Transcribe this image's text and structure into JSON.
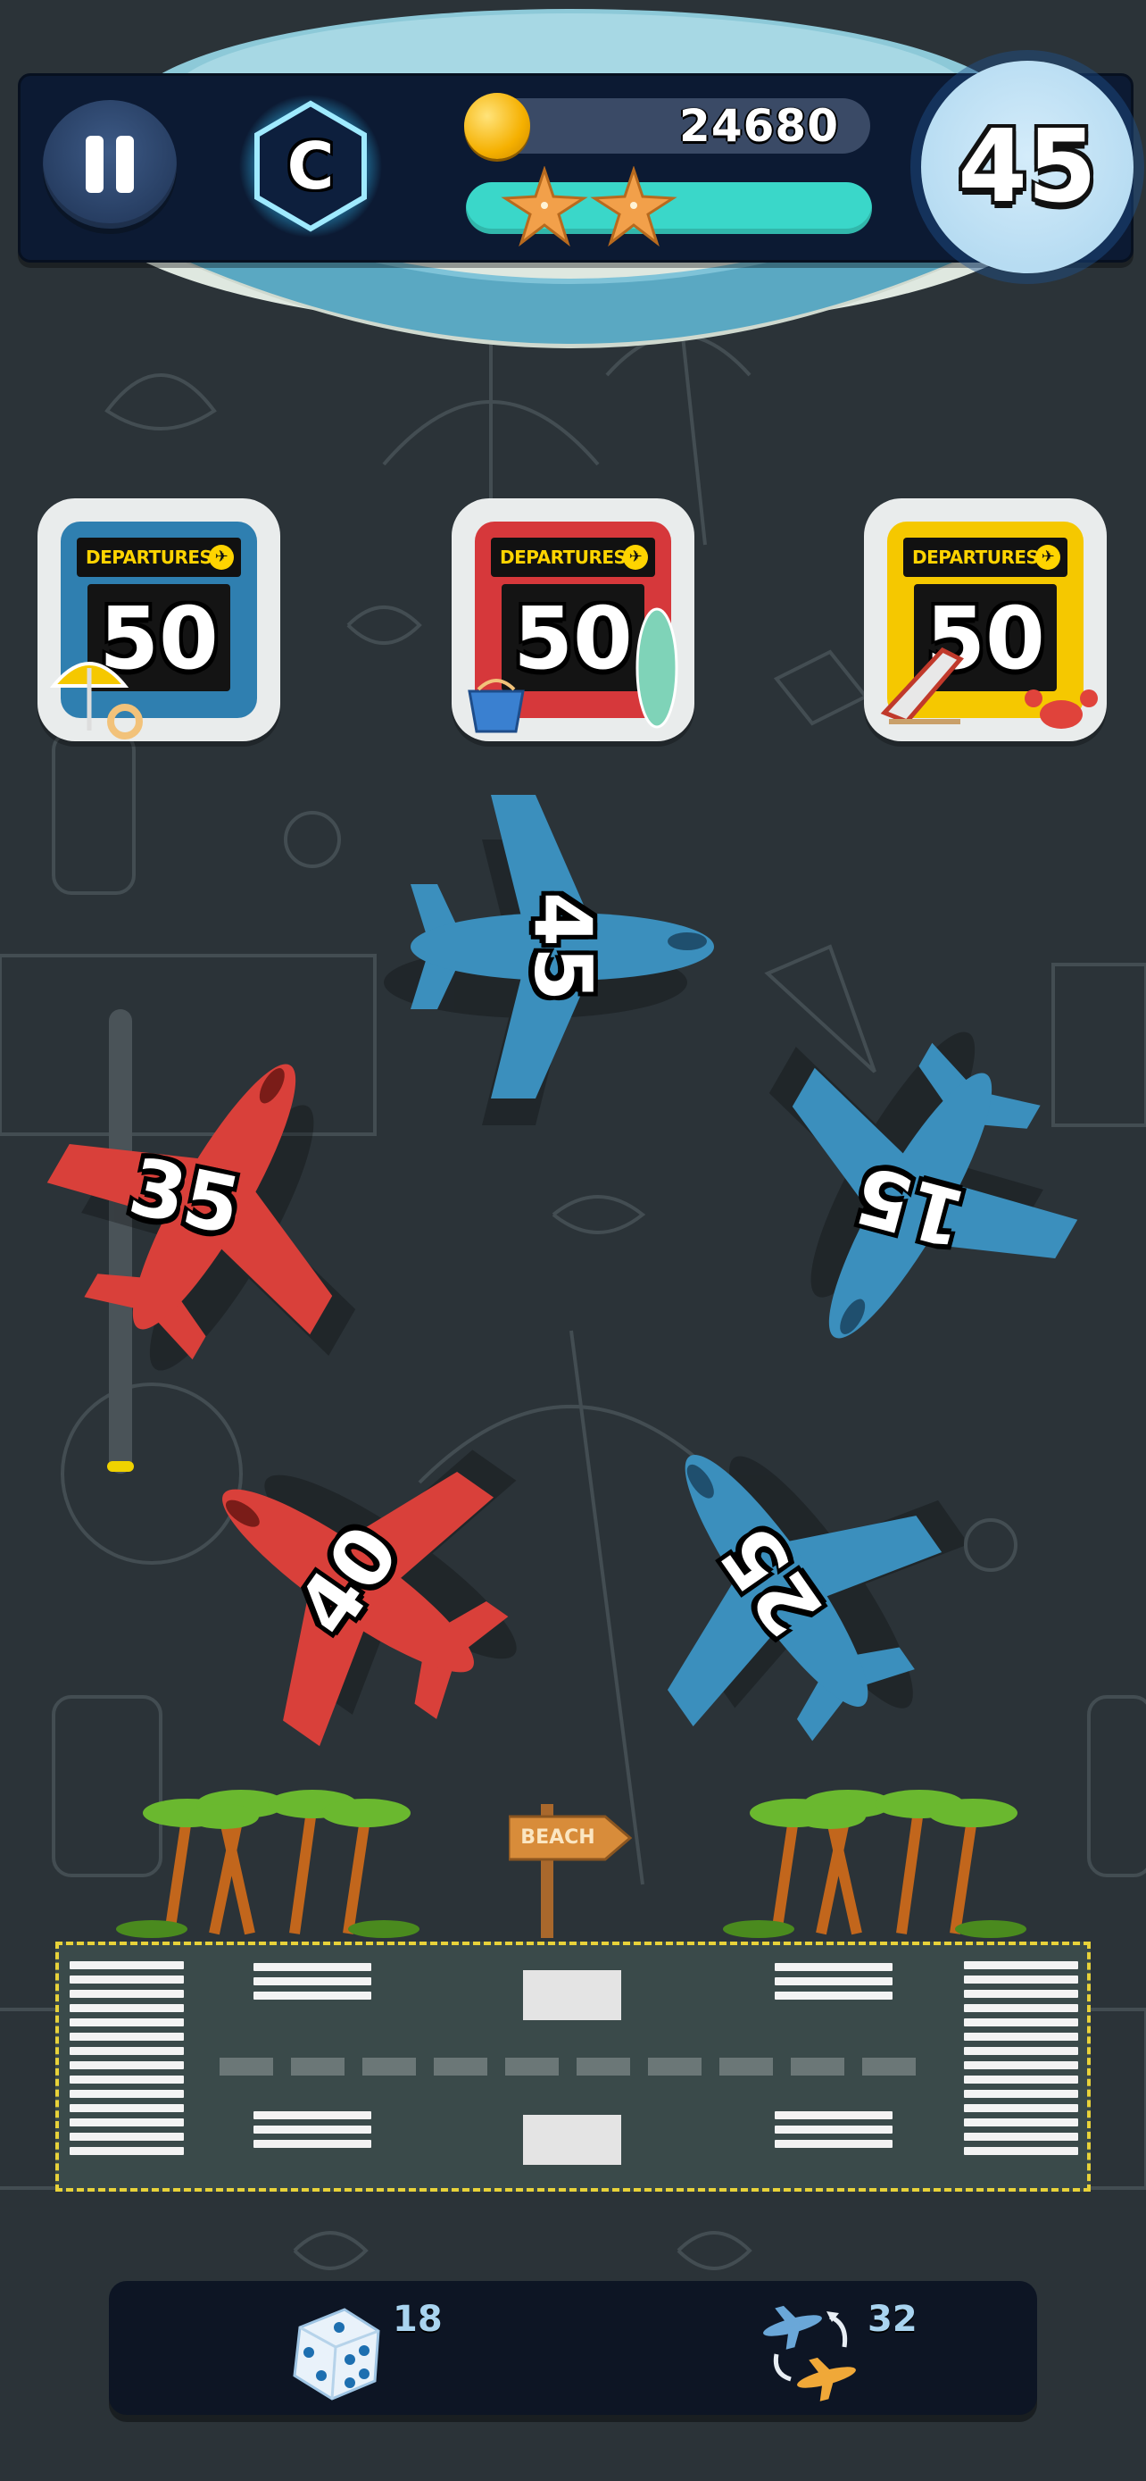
{
  "hud": {
    "stage_letter": "C",
    "coins": "24680",
    "stars_earned": 2,
    "level": "45"
  },
  "gates": [
    {
      "sign": "DEPARTURES",
      "number": "50",
      "color": "#2f7fb0",
      "theme": "blue"
    },
    {
      "sign": "DEPARTURES",
      "number": "50",
      "color": "#d6383b",
      "theme": "red"
    },
    {
      "sign": "DEPARTURES",
      "number": "50",
      "color": "#f5c800",
      "theme": "yellow"
    }
  ],
  "planes": [
    {
      "number": "45",
      "color": "#3b8fbd",
      "theme": "blue"
    },
    {
      "number": "35",
      "color": "#d9403a",
      "theme": "red"
    },
    {
      "number": "15",
      "color": "#3b8fbd",
      "theme": "blue"
    },
    {
      "number": "40",
      "color": "#d9403a",
      "theme": "red"
    },
    {
      "number": "25",
      "color": "#3b8fbd",
      "theme": "blue"
    }
  ],
  "sign_text": "BEACH",
  "powerups": {
    "dice_count": "18",
    "swap_count": "32"
  },
  "icons": {
    "pause": "pause-icon",
    "coin": "coin-icon",
    "star": "starfish-icon",
    "dice": "dice-icon",
    "swap": "swap-planes-icon"
  }
}
